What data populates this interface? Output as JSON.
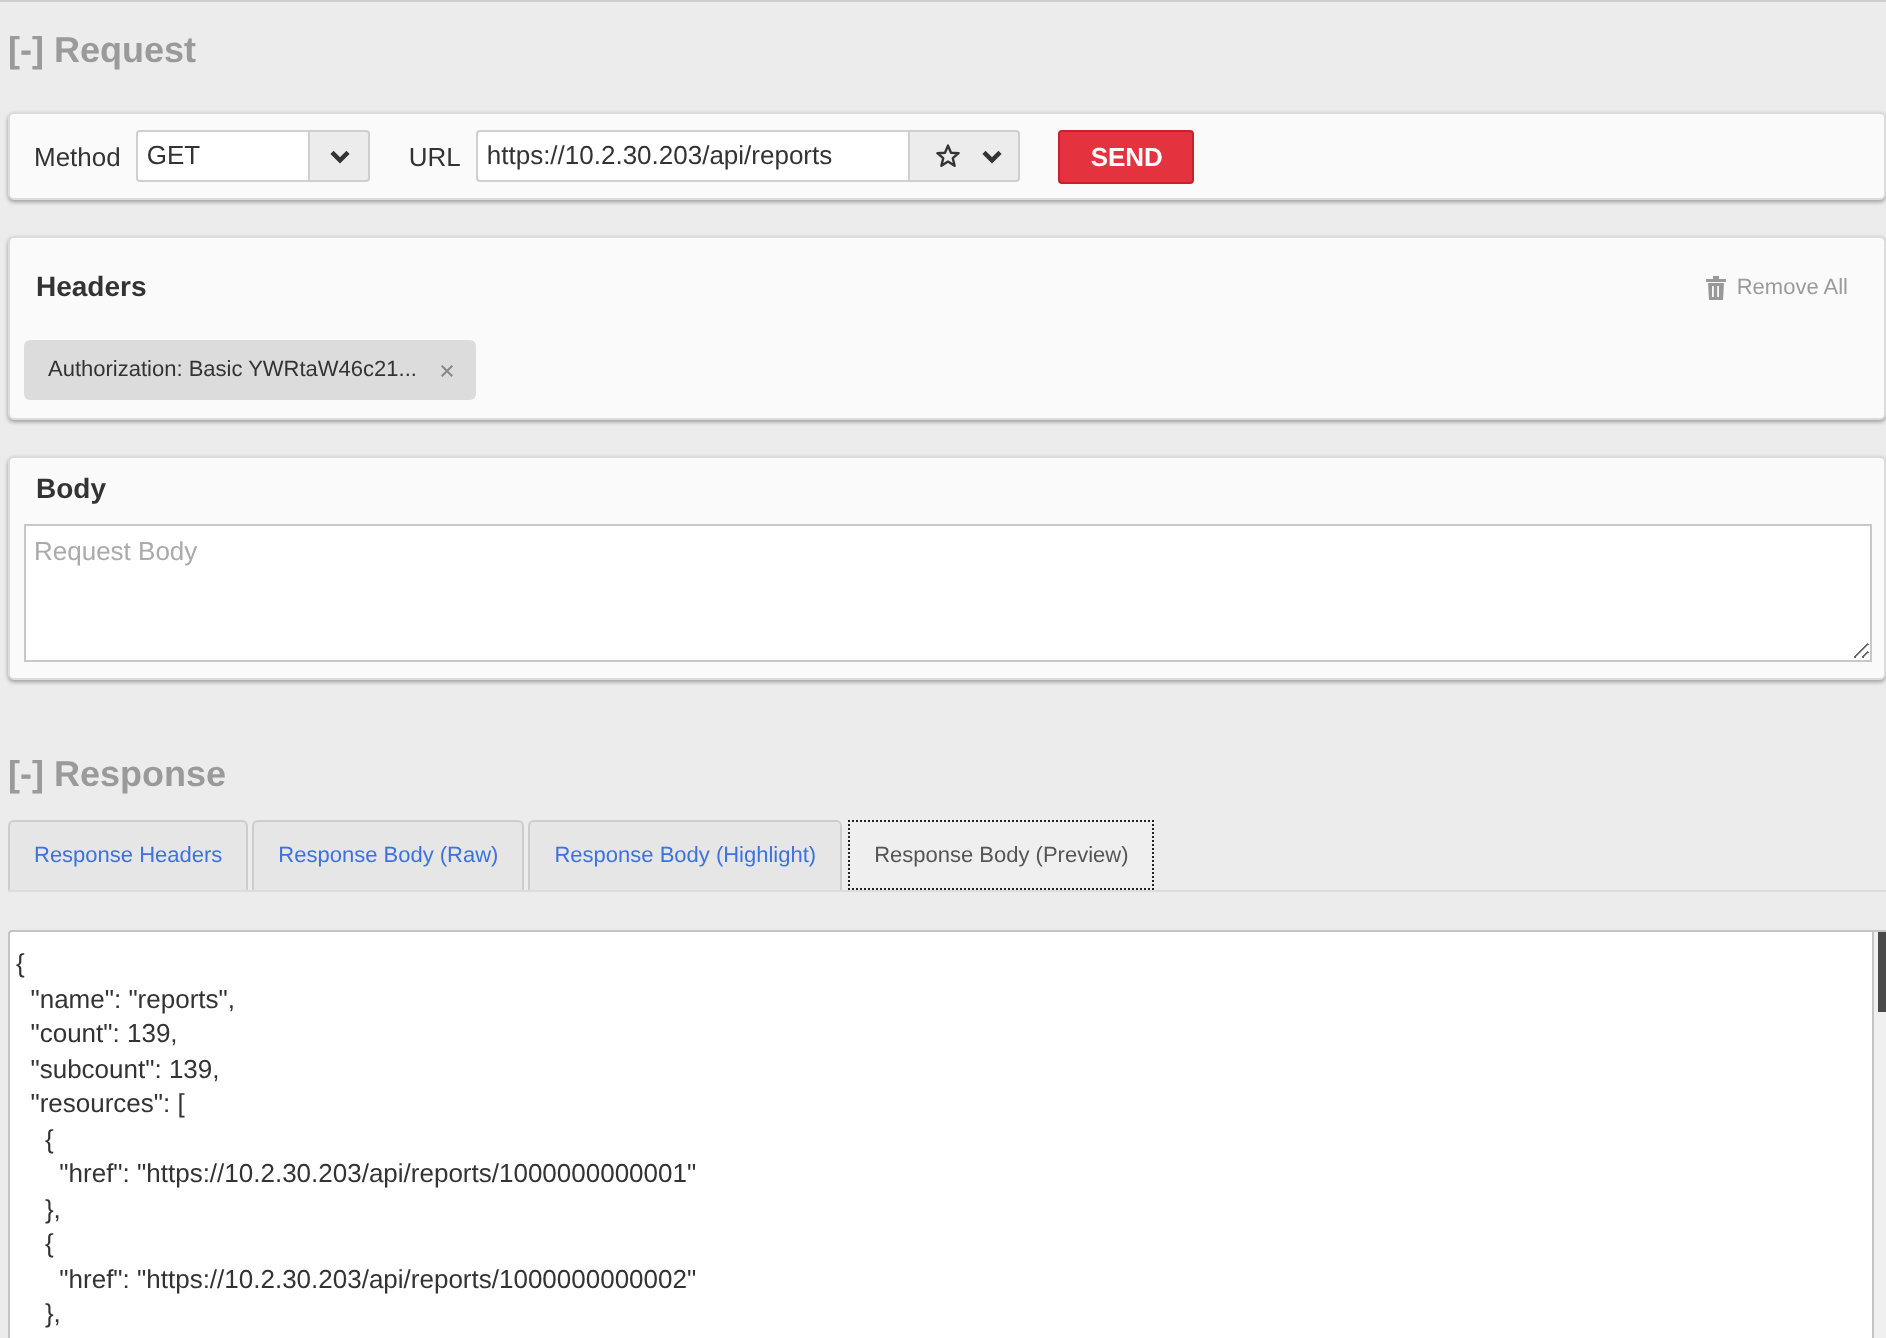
{
  "request": {
    "title": "[-] Request",
    "method": {
      "label": "Method",
      "value": "GET"
    },
    "url": {
      "label": "URL",
      "value": "https://10.2.30.203/api/reports"
    },
    "send_button": "SEND"
  },
  "headers": {
    "title": "Headers",
    "remove_all": "Remove All",
    "items": [
      {
        "text": "Authorization: Basic YWRtaW46c21..."
      }
    ]
  },
  "body": {
    "title": "Body",
    "placeholder": "Request Body"
  },
  "response": {
    "title": "[-] Response",
    "tabs": [
      {
        "label": "Response Headers",
        "selected": false
      },
      {
        "label": "Response Body (Raw)",
        "selected": false
      },
      {
        "label": "Response Body (Highlight)",
        "selected": false
      },
      {
        "label": "Response Body (Preview)",
        "selected": true
      }
    ],
    "body_lines": [
      "{",
      "  \"name\": \"reports\",",
      "  \"count\": 139,",
      "  \"subcount\": 139,",
      "  \"resources\": [",
      "    {",
      "      \"href\": \"https://10.2.30.203/api/reports/1000000000001\"",
      "    },",
      "    {",
      "      \"href\": \"https://10.2.30.203/api/reports/1000000000002\"",
      "    },"
    ]
  }
}
